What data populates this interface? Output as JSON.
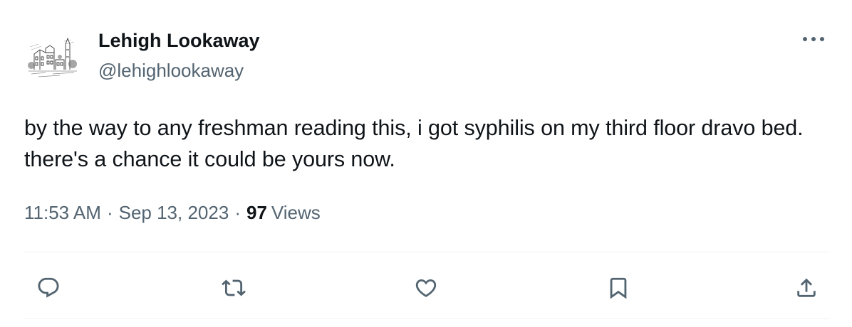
{
  "author": {
    "display_name": "Lehigh Lookaway",
    "handle": "@lehighlookaway",
    "avatar_icon": "building-sketch-avatar"
  },
  "tweet": {
    "text": "by the way to any freshman reading this, i got syphilis on my third floor dravo bed. there's a chance it could be yours now.",
    "time": "11:53 AM",
    "separator": "·",
    "date": "Sep 13, 2023",
    "views_count": "97",
    "views_label": "Views"
  },
  "actions": {
    "reply_icon": "speech-bubble-icon",
    "retweet_icon": "retweet-arrows-icon",
    "like_icon": "heart-icon",
    "bookmark_icon": "bookmark-icon",
    "share_icon": "share-upload-icon",
    "more_icon": "ellipsis-icon"
  },
  "colors": {
    "text_primary": "#0f1419",
    "text_secondary": "#536471",
    "divider": "#eff3f4"
  }
}
